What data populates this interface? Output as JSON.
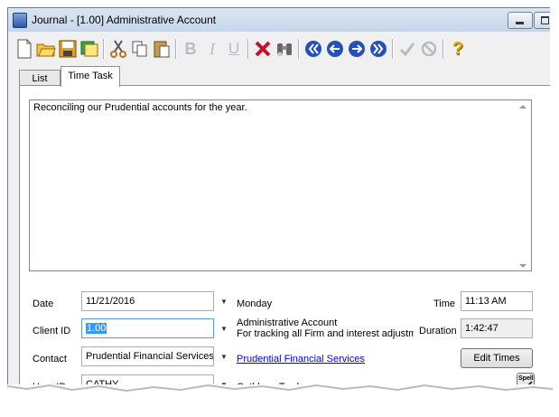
{
  "window": {
    "title": "Journal - [1.00] Administrative Account"
  },
  "toolbar": {
    "icons": [
      "new-document-icon",
      "open-folder-icon",
      "save-icon",
      "notes-icon",
      "cut-icon",
      "copy-icon",
      "paste-icon",
      "bold-icon",
      "italic-icon",
      "underline-icon",
      "delete-icon",
      "binoculars-icon",
      "first-record-icon",
      "previous-record-icon",
      "next-record-icon",
      "last-record-icon",
      "checkmark-icon",
      "cancel-icon",
      "help-icon"
    ],
    "format_labels": {
      "bold": "B",
      "italic": "I",
      "underline": "U"
    },
    "help_label": "?"
  },
  "tabs": [
    {
      "label": "List",
      "active": false
    },
    {
      "label": "Time Task",
      "active": true
    }
  ],
  "notes": {
    "text": "Reconciling our Prudential accounts for the year."
  },
  "form": {
    "date": {
      "label": "Date",
      "value": "11/21/2016",
      "day": "Monday"
    },
    "time": {
      "label": "Time",
      "value": "11:13 AM"
    },
    "client": {
      "label": "Client ID",
      "value": "1.00",
      "name": "Administrative Account",
      "description": "For tracking all Firm and interest adjustme"
    },
    "duration": {
      "label": "Duration",
      "value": "1:42:47"
    },
    "contact": {
      "label": "Contact",
      "value": "Prudential Financial Services",
      "link": "Prudential Financial Services"
    },
    "edit_times_label": "Edit Times",
    "user": {
      "label": "User ID",
      "value": "CATHY",
      "name": "Cathleen Trudore"
    },
    "spell_label": "Spell"
  },
  "colors": {
    "selection": "#3399ff",
    "link": "#0000ee",
    "title_bar": "#c7d6ea"
  }
}
